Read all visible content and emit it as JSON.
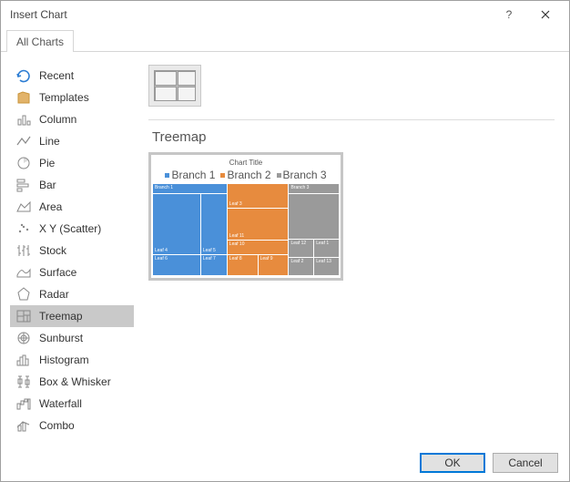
{
  "window": {
    "title": "Insert Chart"
  },
  "tabs": {
    "all_charts": "All Charts"
  },
  "sidebar": {
    "items": [
      {
        "label": "Recent"
      },
      {
        "label": "Templates"
      },
      {
        "label": "Column"
      },
      {
        "label": "Line"
      },
      {
        "label": "Pie"
      },
      {
        "label": "Bar"
      },
      {
        "label": "Area"
      },
      {
        "label": "X Y (Scatter)"
      },
      {
        "label": "Stock"
      },
      {
        "label": "Surface"
      },
      {
        "label": "Radar"
      },
      {
        "label": "Treemap"
      },
      {
        "label": "Sunburst"
      },
      {
        "label": "Histogram"
      },
      {
        "label": "Box & Whisker"
      },
      {
        "label": "Waterfall"
      },
      {
        "label": "Combo"
      }
    ],
    "selected_index": 11
  },
  "main": {
    "subtype_title": "Treemap",
    "preview": {
      "chart_title": "Chart Title",
      "legend": [
        "Branch 1",
        "Branch 2",
        "Branch 3"
      ],
      "colors": {
        "branch1": "#4a90d9",
        "branch2": "#e78b3e",
        "branch3": "#9a9a9a"
      },
      "branch1": {
        "hdr": "Branch 1",
        "leaves": [
          "Leaf 4",
          "Leaf 5",
          "Leaf 6",
          "Leaf 7"
        ]
      },
      "branch2": {
        "leaves": [
          "Leaf 3",
          "Leaf 11",
          "Leaf 10",
          "Leaf 8",
          "Leaf 9"
        ]
      },
      "branch3": {
        "hdr": "Branch 3",
        "leaves": [
          "Leaf 12",
          "Leaf 1",
          "Leaf 2",
          "Leaf 13"
        ]
      }
    }
  },
  "buttons": {
    "ok": "OK",
    "cancel": "Cancel"
  },
  "chart_data": {
    "type": "treemap",
    "title": "Chart Title",
    "series": [
      {
        "name": "Branch 1",
        "color": "#4a90d9",
        "children": [
          {
            "name": "Leaf 4"
          },
          {
            "name": "Leaf 5"
          },
          {
            "name": "Leaf 6"
          },
          {
            "name": "Leaf 7"
          }
        ]
      },
      {
        "name": "Branch 2",
        "color": "#e78b3e",
        "children": [
          {
            "name": "Leaf 3"
          },
          {
            "name": "Leaf 11"
          },
          {
            "name": "Leaf 10"
          },
          {
            "name": "Leaf 8"
          },
          {
            "name": "Leaf 9"
          }
        ]
      },
      {
        "name": "Branch 3",
        "color": "#9a9a9a",
        "children": [
          {
            "name": "Leaf 12"
          },
          {
            "name": "Leaf 1"
          },
          {
            "name": "Leaf 2"
          },
          {
            "name": "Leaf 13"
          }
        ]
      }
    ]
  }
}
